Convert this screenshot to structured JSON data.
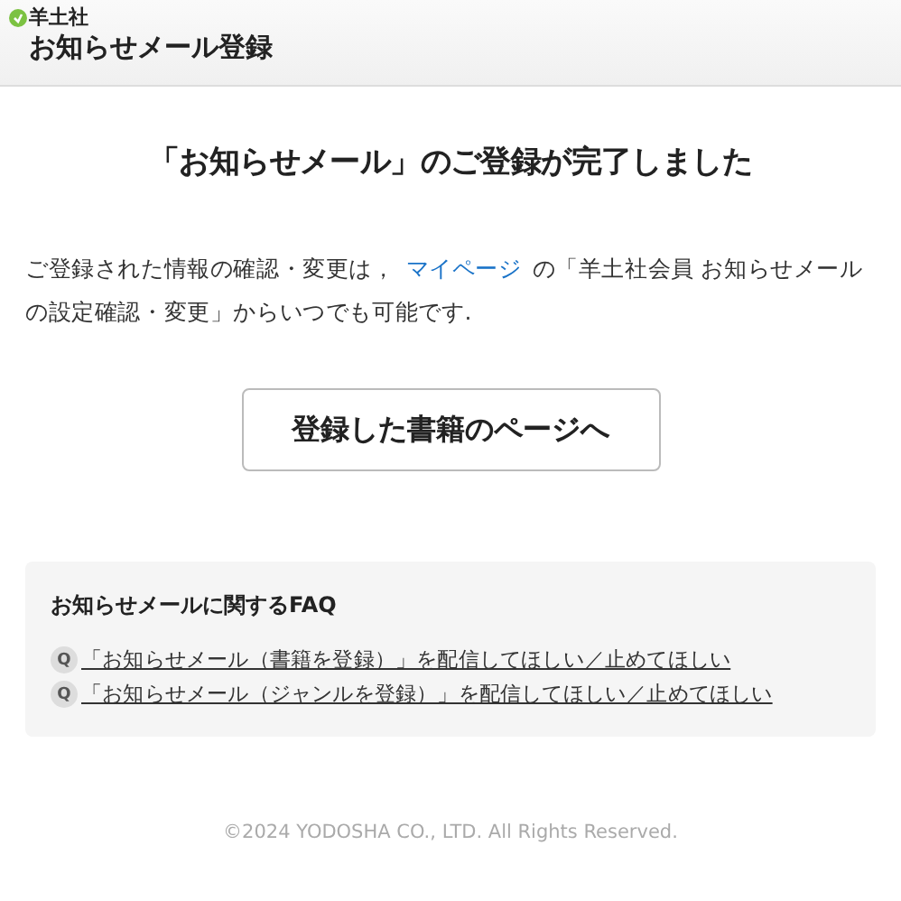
{
  "header": {
    "brand": "羊土社",
    "title": "お知らせメール登録"
  },
  "main": {
    "heading": "「お知らせメール」のご登録が完了しました",
    "message_before": "ご登録された情報の確認・変更は，",
    "message_link": "マイページ",
    "message_after": "の「羊土社会員 お知らせメールの設定確認・変更」からいつでも可能です.",
    "button": "登録した書籍のページへ"
  },
  "faq": {
    "title": "お知らせメールに関するFAQ",
    "items": [
      {
        "badge": "Q",
        "text": "「お知らせメール（書籍を登録）」を配信してほしい／止めてほしい"
      },
      {
        "badge": "Q",
        "text": "「お知らせメール（ジャンルを登録）」を配信してほしい／止めてほしい"
      }
    ]
  },
  "footer": "©2024 YODOSHA CO., LTD. All Rights Reserved."
}
